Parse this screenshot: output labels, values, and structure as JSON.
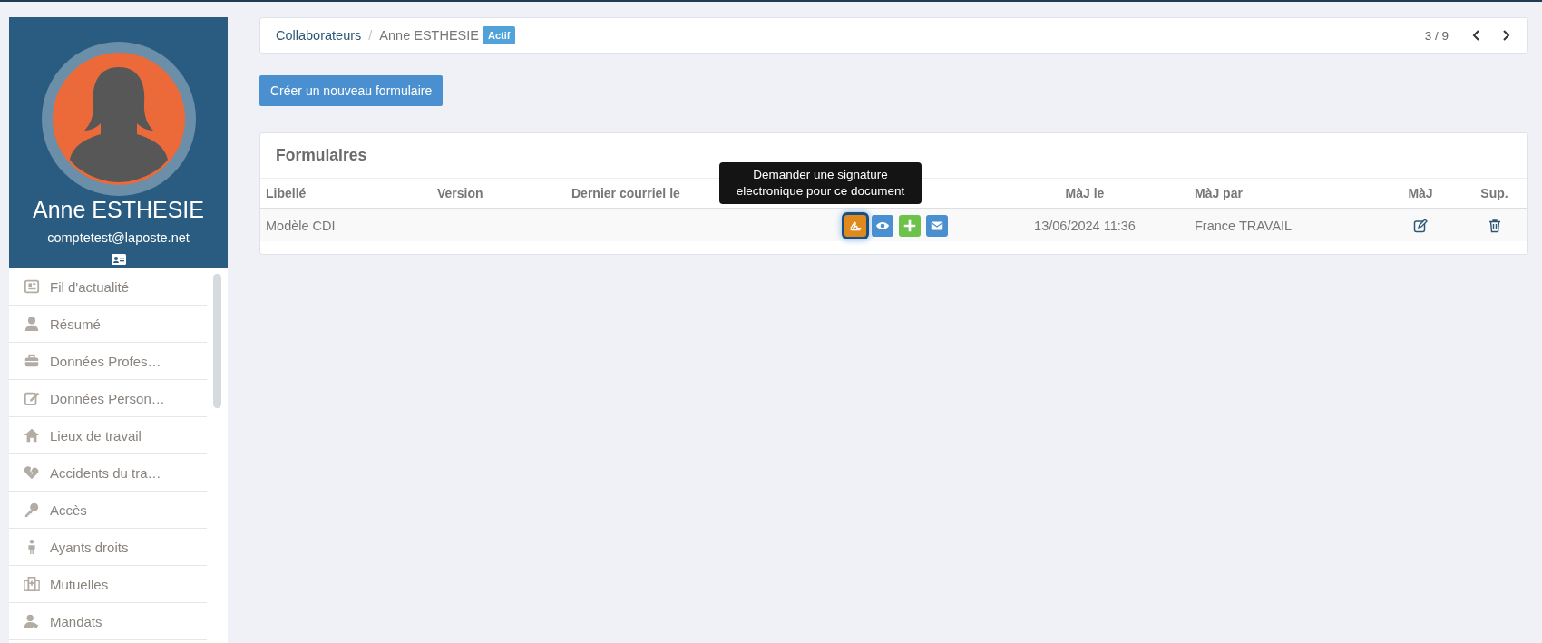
{
  "profile": {
    "name": "Anne ESTHESIE",
    "email": "comptetest@laposte.net"
  },
  "sidebar": {
    "items": [
      {
        "label": "Fil d'actualité"
      },
      {
        "label": "Résumé"
      },
      {
        "label": "Données Profes…"
      },
      {
        "label": "Données Person…"
      },
      {
        "label": "Lieux de travail"
      },
      {
        "label": "Accidents du tra…"
      },
      {
        "label": "Accès"
      },
      {
        "label": "Ayants droits"
      },
      {
        "label": "Mutuelles"
      },
      {
        "label": "Mandats"
      }
    ]
  },
  "breadcrumb": {
    "items": [
      "Collaborateurs",
      "Anne ESTHESIE"
    ],
    "separator": "/",
    "badge": "Actif",
    "pager": "3 / 9"
  },
  "create_button": "Créer un nouveau formulaire",
  "forms": {
    "title": "Formulaires",
    "columns": [
      "Libellé",
      "Version",
      "Dernier courriel le",
      "MàJ le",
      "MàJ par",
      "MàJ",
      "Sup."
    ],
    "rows": [
      {
        "label": "Modèle CDI",
        "version": "",
        "last_mail": "",
        "updated_at": "13/06/2024 11:36",
        "updated_by": "France TRAVAIL",
        "actions": [
          {
            "kind": "signature",
            "focused": true
          },
          {
            "kind": "view",
            "focused": false
          },
          {
            "kind": "add",
            "focused": false
          },
          {
            "kind": "mail",
            "focused": false
          }
        ]
      }
    ]
  },
  "tooltip": "Demander une signature electronique pour ce document"
}
